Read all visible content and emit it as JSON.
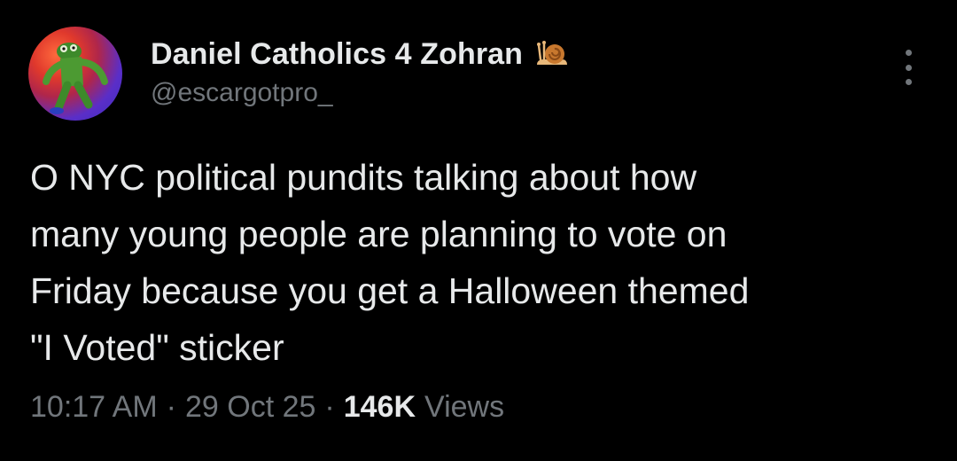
{
  "tweet": {
    "author": {
      "display_name": "Daniel Catholics 4 Zohran",
      "badge_icon": "snail-icon",
      "handle": "@escargotpro_",
      "avatar_icon": "kermit-avatar"
    },
    "text": "O NYC political pundits talking about how\nmany young people are planning to vote on\nFriday because you get a Halloween themed\n\"I Voted\" sticker",
    "time": "10:17 AM",
    "separator": "·",
    "date": "29 Oct 25",
    "views_count": "146K",
    "views_label": "Views"
  },
  "colors": {
    "background": "#000000",
    "primary_text": "#e7e9ea",
    "secondary_text": "#71767b"
  }
}
